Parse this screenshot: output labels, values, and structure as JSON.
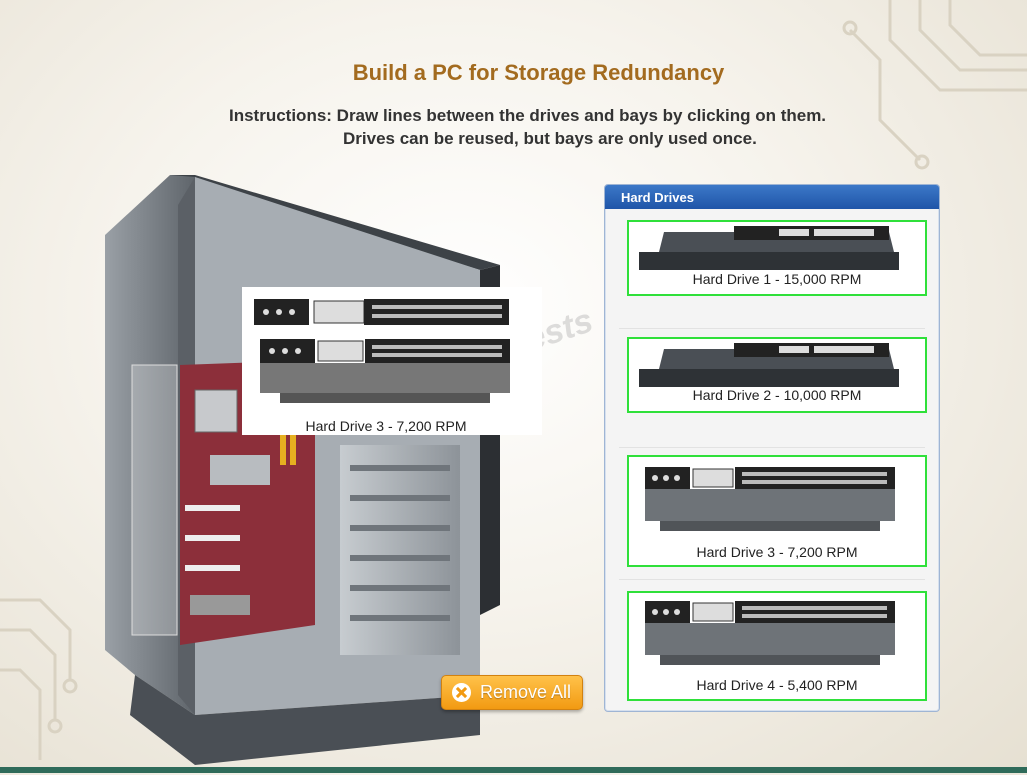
{
  "title": "Build a PC for Storage Redundancy",
  "instructions": {
    "line1": "Instructions: Draw lines between the drives and bays by clicking on them.",
    "line2": "Drives can be reused, but bays are only used once."
  },
  "watermark": "ActualTests",
  "case": {
    "placed_drive_label": "Hard Drive 3 - 7,200 RPM"
  },
  "panel": {
    "title": "Hard Drives",
    "drives": [
      {
        "label": "Hard Drive 1 - 15,000 RPM",
        "icon": "sata-hard-drive-icon"
      },
      {
        "label": "Hard Drive 2 - 10,000 RPM",
        "icon": "sata-hard-drive-icon"
      },
      {
        "label": "Hard Drive 3 - 7,200 RPM",
        "icon": "ide-hard-drive-icon"
      },
      {
        "label": "Hard Drive 4 - 5,400 RPM",
        "icon": "ide-hard-drive-icon"
      }
    ]
  },
  "remove_all": {
    "label": "Remove All",
    "icon": "close-icon"
  },
  "colors": {
    "title": "#a36b1f",
    "selection_border": "#2fe03a",
    "panel_header": "#2a64b8",
    "button": "#f29a12"
  }
}
